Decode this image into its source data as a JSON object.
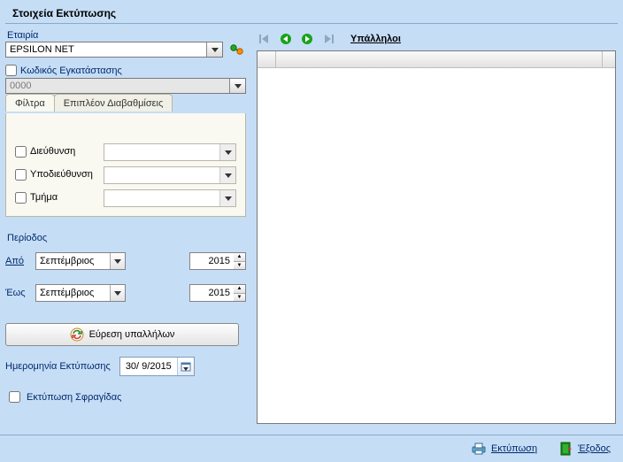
{
  "window_title": "Στοιχεία Εκτύπωσης",
  "company": {
    "label": "Εταιρία",
    "value": "EPSILON NET"
  },
  "install_code": {
    "label": "Κωδικός Εγκατάστασης",
    "value": "0000"
  },
  "tabs": {
    "filters": "Φίλτρα",
    "extra": "Επιπλέον Διαβαθμίσεις"
  },
  "filters": {
    "address": "Διεύθυνση",
    "subaddress": "Υποδιεύθυνση",
    "department": "Τμήμα"
  },
  "period": {
    "label": "Περίοδος",
    "from_lbl": "Από",
    "from_month": "Σεπτέμβριος",
    "from_year": "2015",
    "to_lbl": "Έως",
    "to_month": "Σεπτέμβριος",
    "to_year": "2015"
  },
  "search_btn": "Εύρεση υπαλλήλων",
  "print_date": {
    "label": "Ημερομηνία Εκτύπωσης",
    "value": "30/ 9/2015"
  },
  "stamp_checkbox": "Εκτύπωση Σφραγίδας",
  "right": {
    "title": "Υπάλληλοι"
  },
  "footer": {
    "print": "Εκτύπωση",
    "exit": "Έξοδος"
  }
}
